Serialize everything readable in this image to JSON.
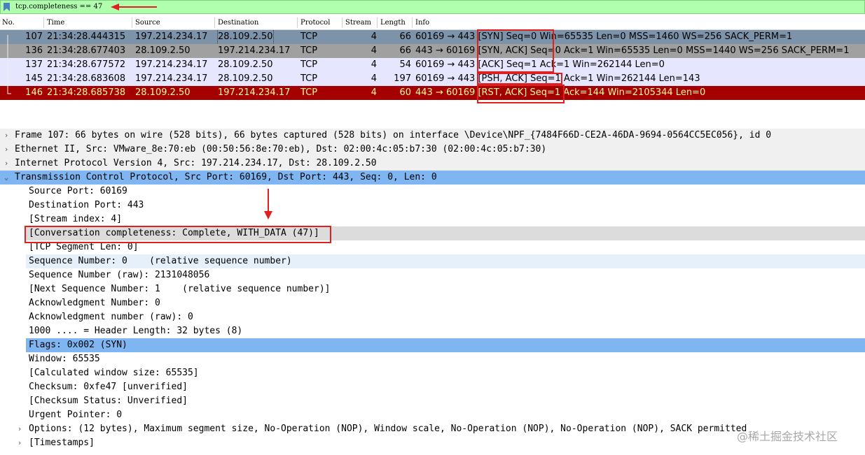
{
  "filter": {
    "expression": "tcp.completeness == 47",
    "row_color": "#afffaf"
  },
  "columns": [
    "No.",
    "Time",
    "Source",
    "Destination",
    "Protocol",
    "Stream",
    "Length",
    "Info"
  ],
  "packets": [
    {
      "no": "107",
      "time": "21:34:28.444315",
      "src": "197.214.234.17",
      "dst": "28.109.2.50",
      "proto": "TCP",
      "stream": "4",
      "len": "66",
      "info": "60169 → 443 [SYN] Seq=0 Win=65535 Len=0 MSS=1460 WS=256 SACK_PERM=1",
      "bg": "#7d93a9",
      "fg": "#000000"
    },
    {
      "no": "136",
      "time": "21:34:28.677403",
      "src": "28.109.2.50",
      "dst": "197.214.234.17",
      "proto": "TCP",
      "stream": "4",
      "len": "66",
      "info": "443 → 60169 [SYN, ACK] Seq=0 Ack=1 Win=65535 Len=0 MSS=1440 WS=256 SACK_PERM=1",
      "bg": "#a0a0a0",
      "fg": "#000000"
    },
    {
      "no": "137",
      "time": "21:34:28.677572",
      "src": "197.214.234.17",
      "dst": "28.109.2.50",
      "proto": "TCP",
      "stream": "4",
      "len": "54",
      "info": "60169 → 443 [ACK] Seq=1 Ack=1 Win=262144 Len=0",
      "bg": "#e7e6ff",
      "fg": "#000000"
    },
    {
      "no": "145",
      "time": "21:34:28.683608",
      "src": "197.214.234.17",
      "dst": "28.109.2.50",
      "proto": "TCP",
      "stream": "4",
      "len": "197",
      "info": "60169 → 443 [PSH, ACK] Seq=1 Ack=1 Win=262144 Len=143",
      "bg": "#e7e6ff",
      "fg": "#000000"
    },
    {
      "no": "146",
      "time": "21:34:28.685738",
      "src": "28.109.2.50",
      "dst": "197.214.234.17",
      "proto": "TCP",
      "stream": "4",
      "len": "60",
      "info": "443 → 60169 [RST, ACK] Seq=1 Ack=144 Win=2105344 Len=0",
      "bg": "#a40000",
      "fg": "#fffc9c"
    }
  ],
  "details": [
    {
      "text": "Frame 107: 66 bytes on wire (528 bits), 66 bytes captured (528 bits) on interface \\Device\\NPF_{7484F66D-CE2A-46DA-9694-0564CC5EC056}, id 0",
      "toggle": "›",
      "indent": 0,
      "style": "grey"
    },
    {
      "text": "Ethernet II, Src: VMware_8e:70:eb (00:50:56:8e:70:eb), Dst: 02:00:4c:05:b7:30 (02:00:4c:05:b7:30)",
      "toggle": "›",
      "indent": 0,
      "style": "grey"
    },
    {
      "text": "Internet Protocol Version 4, Src: 197.214.234.17, Dst: 28.109.2.50",
      "toggle": "›",
      "indent": 0,
      "style": "grey"
    },
    {
      "text": "Transmission Control Protocol, Src Port: 60169, Dst Port: 443, Seq: 0, Len: 0",
      "toggle": "⌄",
      "indent": 0,
      "style": "blue"
    },
    {
      "text": "Source Port: 60169",
      "toggle": "",
      "indent": 1,
      "style": "none"
    },
    {
      "text": "Destination Port: 443",
      "toggle": "",
      "indent": 1,
      "style": "none"
    },
    {
      "text": "[Stream index: 4]",
      "toggle": "",
      "indent": 1,
      "style": "none"
    },
    {
      "text": "[Conversation completeness: Complete, WITH_DATA (47)]",
      "toggle": "",
      "indent": 1,
      "style": "sel"
    },
    {
      "text": "[TCP Segment Len: 0]",
      "toggle": "",
      "indent": 1,
      "style": "none"
    },
    {
      "text": "Sequence Number: 0    (relative sequence number)",
      "toggle": "",
      "indent": 1,
      "style": "light"
    },
    {
      "text": "Sequence Number (raw): 2131048056",
      "toggle": "",
      "indent": 1,
      "style": "none"
    },
    {
      "text": "[Next Sequence Number: 1    (relative sequence number)]",
      "toggle": "",
      "indent": 1,
      "style": "none"
    },
    {
      "text": "Acknowledgment Number: 0",
      "toggle": "",
      "indent": 1,
      "style": "none"
    },
    {
      "text": "Acknowledgment number (raw): 0",
      "toggle": "",
      "indent": 1,
      "style": "none"
    },
    {
      "text": "1000 .... = Header Length: 32 bytes (8)",
      "toggle": "",
      "indent": 1,
      "style": "none"
    },
    {
      "text": "Flags: 0x002 (SYN)",
      "toggle": "›",
      "indent": 1,
      "style": "blue"
    },
    {
      "text": "Window: 65535",
      "toggle": "",
      "indent": 1,
      "style": "none"
    },
    {
      "text": "[Calculated window size: 65535]",
      "toggle": "",
      "indent": 1,
      "style": "none"
    },
    {
      "text": "Checksum: 0xfe47 [unverified]",
      "toggle": "",
      "indent": 1,
      "style": "none"
    },
    {
      "text": "[Checksum Status: Unverified]",
      "toggle": "",
      "indent": 1,
      "style": "none"
    },
    {
      "text": "Urgent Pointer: 0",
      "toggle": "",
      "indent": 1,
      "style": "none"
    },
    {
      "text": "Options: (12 bytes), Maximum segment size, No-Operation (NOP), Window scale, No-Operation (NOP), No-Operation (NOP), SACK permitted",
      "toggle": "›",
      "indent": 1,
      "style": "none"
    },
    {
      "text": "[Timestamps]",
      "toggle": "›",
      "indent": 1,
      "style": "none"
    }
  ],
  "annotation_color": "#e02020",
  "watermark": "@稀土掘金技术社区"
}
